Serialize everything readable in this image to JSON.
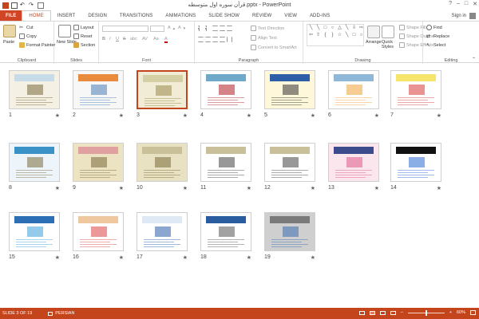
{
  "window": {
    "title": "قرآن سوره اول متوسطه.pptx - PowerPoint",
    "controls": [
      "?",
      "–",
      "□",
      "✕"
    ]
  },
  "tabs": [
    "FILE",
    "HOME",
    "INSERT",
    "DESIGN",
    "TRANSITIONS",
    "ANIMATIONS",
    "SLIDE SHOW",
    "REVIEW",
    "VIEW",
    "ADD-INS"
  ],
  "active_tab": "HOME",
  "sign_in": "Sign in",
  "ribbon": {
    "clipboard": {
      "label": "Clipboard",
      "paste": "Paste",
      "cut": "Cut",
      "copy": "Copy",
      "format_painter": "Format Painter"
    },
    "slides": {
      "label": "Slides",
      "new_slide": "New Slide",
      "layout": "Layout",
      "reset": "Reset",
      "section": "Section"
    },
    "font": {
      "label": "Font",
      "bold": "B",
      "italic": "I",
      "underline": "U",
      "strike": "S",
      "shadow": "abc",
      "spacing": "AV",
      "case": "Aa",
      "color": "A"
    },
    "paragraph": {
      "label": "Paragraph",
      "text_direction": "Text Direction",
      "align_text": "Align Text",
      "convert_smartart": "Convert to SmartArt"
    },
    "drawing": {
      "label": "Drawing",
      "arrange": "Arrange",
      "quick_styles": "Quick Styles",
      "shape_fill": "Shape Fill",
      "shape_outline": "Shape Outline",
      "shape_effects": "Shape Effects"
    },
    "editing": {
      "label": "Editing",
      "find": "Find",
      "replace": "Replace",
      "select": "Select"
    }
  },
  "slides": [
    {
      "num": "1",
      "bg": "#f4f1e4",
      "band": "#c8dbe8",
      "accent": "#7a6a3a"
    },
    {
      "num": "2",
      "bg": "#f7f7f7",
      "band": "#e98a3c",
      "accent": "#4a7db5"
    },
    {
      "num": "3",
      "bg": "#f0ecd6",
      "band": "#d5cfa6",
      "accent": "#9a8b4a"
    },
    {
      "num": "4",
      "bg": "#ffffff",
      "band": "#6fa9c9",
      "accent": "#b21e25"
    },
    {
      "num": "5",
      "bg": "#fff7d9",
      "band": "#2f5ea8",
      "accent": "#333333"
    },
    {
      "num": "6",
      "bg": "#ffffff",
      "band": "#8fb7d8",
      "accent": "#f0a23a"
    },
    {
      "num": "7",
      "bg": "#ffffff",
      "band": "#f5e56b",
      "accent": "#d93a3a"
    },
    {
      "num": "8",
      "bg": "#eef5fa",
      "band": "#3a92c6",
      "accent": "#7a6a3a"
    },
    {
      "num": "9",
      "bg": "#ece3c3",
      "band": "#e0a0a0",
      "accent": "#7a6a3a"
    },
    {
      "num": "10",
      "bg": "#e9e2c2",
      "band": "#c9c09a",
      "accent": "#7a6a3a"
    },
    {
      "num": "11",
      "bg": "#ffffff",
      "band": "#c9c09a",
      "accent": "#444444"
    },
    {
      "num": "12",
      "bg": "#ffffff",
      "band": "#c9c09a",
      "accent": "#444444"
    },
    {
      "num": "13",
      "bg": "#fbe6ee",
      "band": "#3b4b8c",
      "accent": "#e05a8a"
    },
    {
      "num": "14",
      "bg": "#ffffff",
      "band": "#111111",
      "accent": "#2b6bd1"
    },
    {
      "num": "15",
      "bg": "#ffffff",
      "band": "#2d6fb5",
      "accent": "#3da0d8"
    },
    {
      "num": "16",
      "bg": "#ffffff",
      "band": "#f0c8a0",
      "accent": "#d44"
    },
    {
      "num": "17",
      "bg": "#ffffff",
      "band": "#dfe9f5",
      "accent": "#2b5fa8"
    },
    {
      "num": "18",
      "bg": "#ffffff",
      "band": "#2a5d9f",
      "accent": "#555555"
    },
    {
      "num": "19",
      "bg": "#cfcfcf",
      "band": "#7a7a7a",
      "accent": "#3a6fb0"
    }
  ],
  "selected_slide": "3",
  "status": {
    "slide": "SLIDE 3 OF 19",
    "language": "PERSIAN",
    "zoom": "60%"
  }
}
